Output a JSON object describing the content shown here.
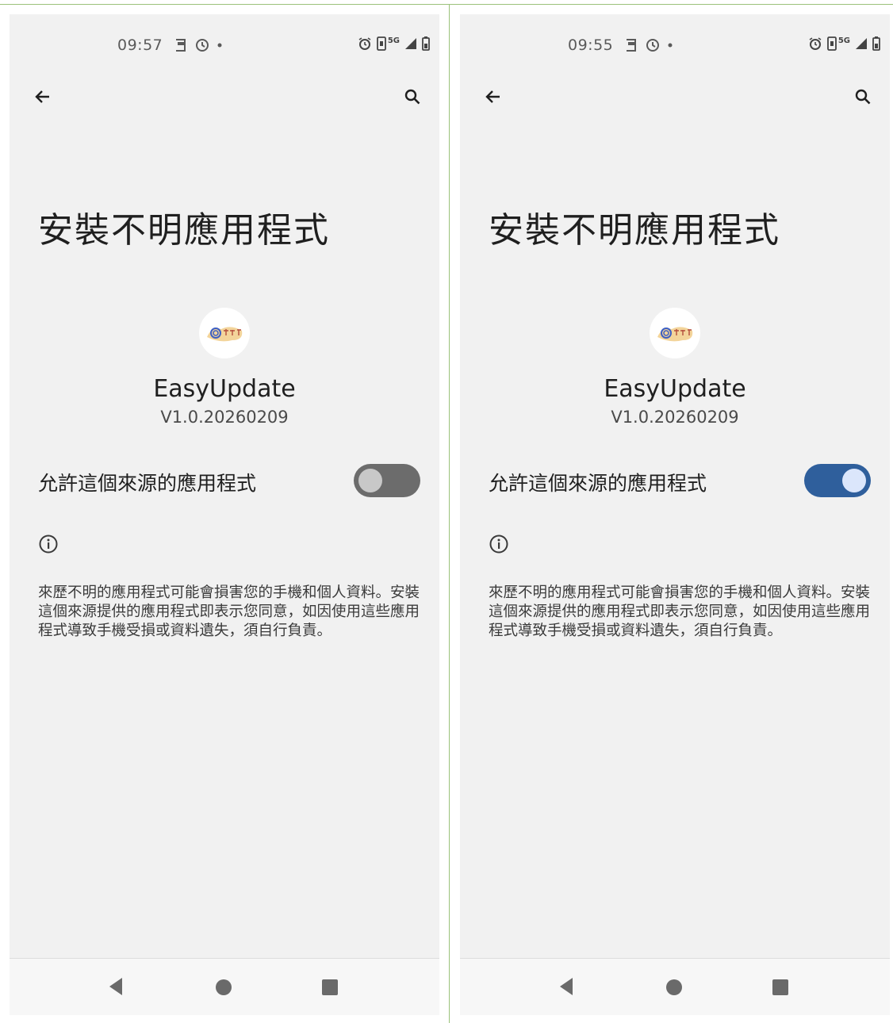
{
  "screens": [
    {
      "status_time": "09:57",
      "title": "安裝不明應用程式",
      "app_name": "EasyUpdate",
      "app_version": "V1.0.20260209",
      "allow_label": "允許這個來源的應用程式",
      "allow_enabled": false,
      "warning": "來歷不明的應用程式可能會損害您的手機和個人資料。安裝這個來源提供的應用程式即表示您同意，如因使用這些應用程式導致手機受損或資料遺失，須自行負責。"
    },
    {
      "status_time": "09:55",
      "title": "安裝不明應用程式",
      "app_name": "EasyUpdate",
      "app_version": "V1.0.20260209",
      "allow_label": "允許這個來源的應用程式",
      "allow_enabled": true,
      "warning": "來歷不明的應用程式可能會損害您的手機和個人資料。安裝這個來源提供的應用程式即表示您同意，如因使用這些應用程式導致手機受損或資料遺失，須自行負責。"
    }
  ],
  "status_icons": {
    "network_label": "5G"
  },
  "colors": {
    "background": "#f1f1f1",
    "switch_on": "#2f5f9c",
    "switch_off": "#6c6c6c",
    "frame_line": "#9bc27a"
  }
}
